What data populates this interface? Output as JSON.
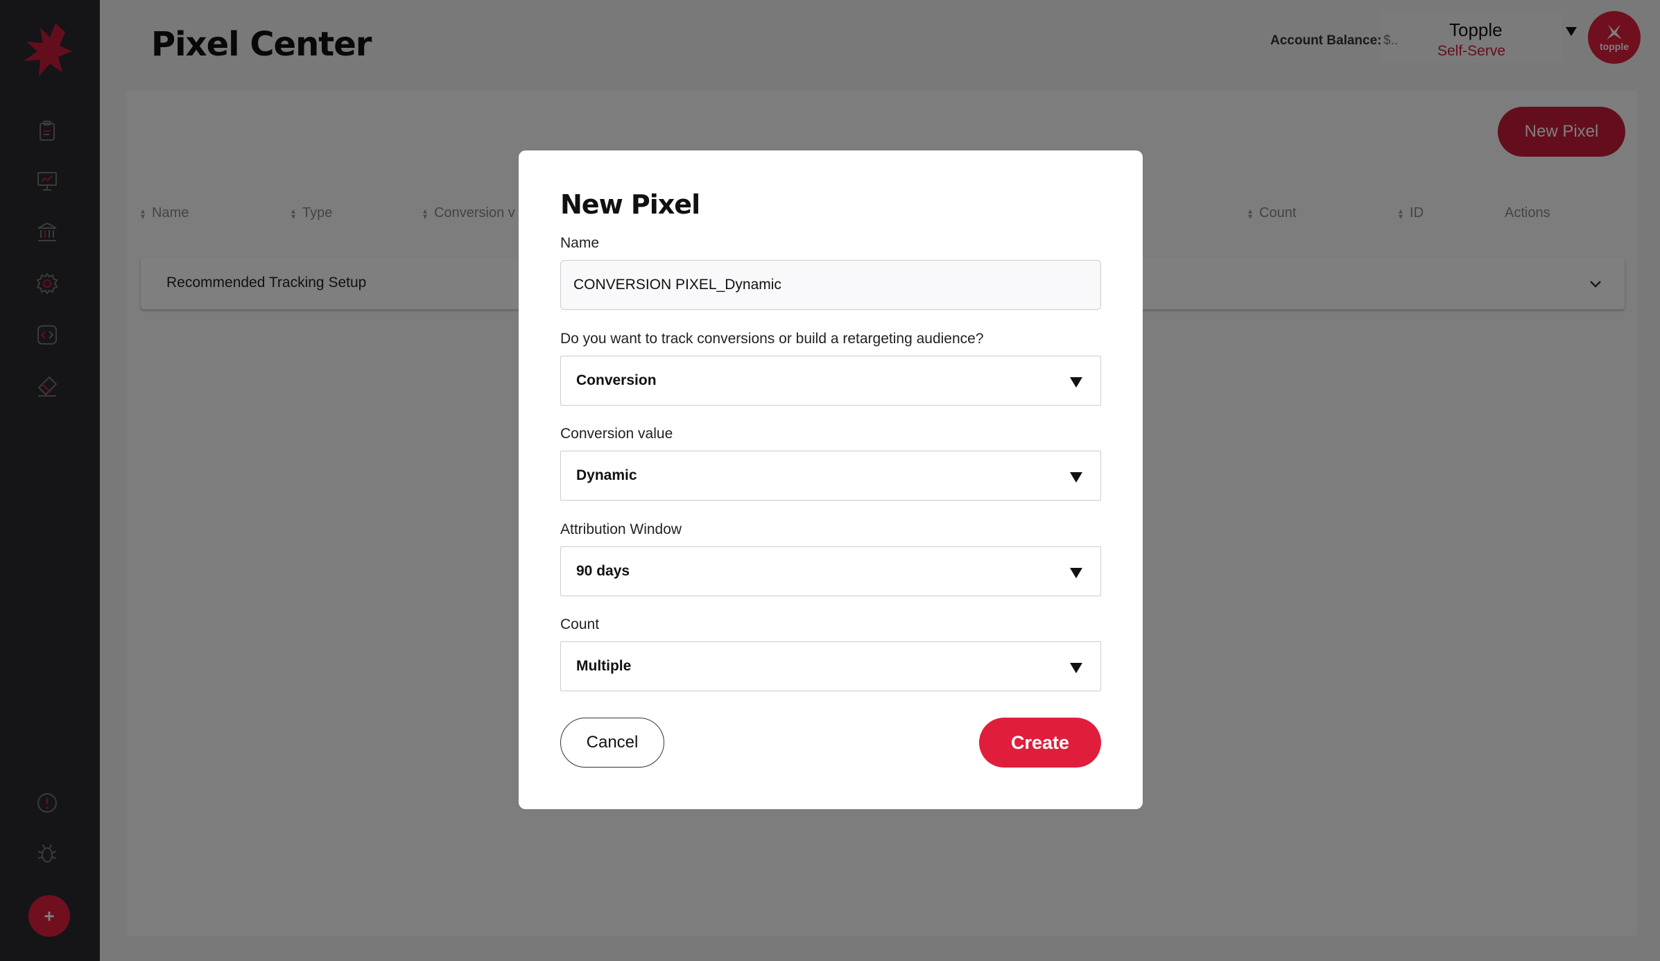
{
  "header": {
    "page_title": "Pixel Center",
    "account_balance_label": "Account Balance:",
    "account_balance_value": "$..",
    "account_name": "Topple",
    "account_type": "Self-Serve",
    "avatar_text": "topple"
  },
  "toolbar": {
    "new_pixel_label": "New Pixel"
  },
  "table": {
    "columns": [
      "Name",
      "Type",
      "Conversion v",
      "Count",
      "ID",
      "Actions"
    ],
    "accordion_label": "Recommended Tracking Setup"
  },
  "sidebar": {
    "add_label": "+"
  },
  "modal": {
    "title": "New Pixel",
    "name_label": "Name",
    "name_value": "CONVERSION PIXEL_Dynamic",
    "track_label": "Do you want to track conversions or build a retargeting audience?",
    "track_value": "Conversion",
    "conversion_value_label": "Conversion value",
    "conversion_value_value": "Dynamic",
    "attribution_label": "Attribution Window",
    "attribution_value": "90 days",
    "count_label": "Count",
    "count_value": "Multiple",
    "cancel_label": "Cancel",
    "create_label": "Create"
  },
  "colors": {
    "brand": "#e01e3c",
    "brand_dark": "#c81d3a",
    "sidebar": "#2b2b31"
  }
}
